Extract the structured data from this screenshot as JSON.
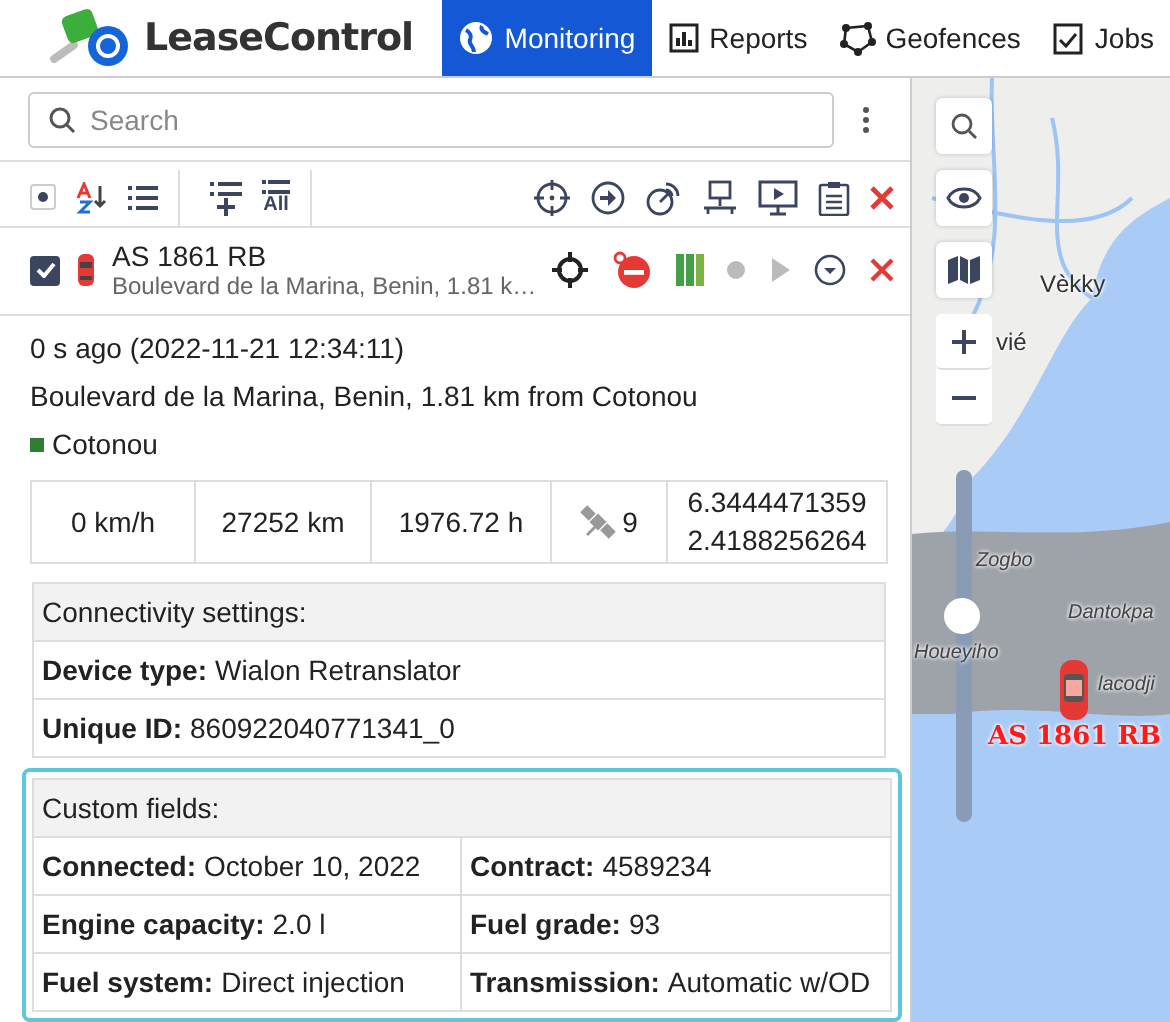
{
  "header": {
    "logo": "LeaseControl",
    "nav": [
      {
        "label": "Monitoring",
        "selected": true
      },
      {
        "label": "Reports",
        "selected": false
      },
      {
        "label": "Geofences",
        "selected": false
      },
      {
        "label": "Jobs",
        "selected": false
      }
    ]
  },
  "search": {
    "placeholder": "Search"
  },
  "toolbar": {
    "select_all": {
      "indeterminate": true
    },
    "all_label": "All"
  },
  "unit": {
    "checked": true,
    "name": "AS 1861 RB",
    "address": "Boulevard de la Marina, Benin, 1.81 k…"
  },
  "details": {
    "time": "0 s ago (2022-11-21 12:34:11)",
    "address": "Boulevard de la Marina, Benin, 1.81 km from Cotonou",
    "geofence": {
      "name": "Cotonou",
      "color": "#2e7d32"
    }
  },
  "stats": {
    "speed": "0 km/h",
    "mileage": "27252 km",
    "engine_hours": "1976.72 h",
    "satellites": "9",
    "latitude": "6.3444471359",
    "longitude": "2.4188256264"
  },
  "connectivity": {
    "title": "Connectivity settings:",
    "rows": [
      {
        "label": "Device type:",
        "value": "Wialon Retranslator"
      },
      {
        "label": "Unique ID:",
        "value": "860922040771341_0"
      }
    ]
  },
  "custom_fields": {
    "title": "Custom fields:",
    "fields": [
      {
        "label": "Connected:",
        "value": "October 10, 2022"
      },
      {
        "label": "Contract:",
        "value": "4589234"
      },
      {
        "label": "Engine capacity:",
        "value": "2.0 l"
      },
      {
        "label": "Fuel grade:",
        "value": "93"
      },
      {
        "label": "Fuel system:",
        "value": "Direct injection"
      },
      {
        "label": "Transmission:",
        "value": "Automatic w/OD"
      }
    ]
  },
  "map": {
    "labels": [
      "Vèkky",
      "vié",
      "Zogbo",
      "Houeyiho",
      "Dantokpa",
      "lacodji"
    ],
    "unit_label": "AS 1861 RB",
    "zoom": {
      "level": 0.6
    }
  }
}
